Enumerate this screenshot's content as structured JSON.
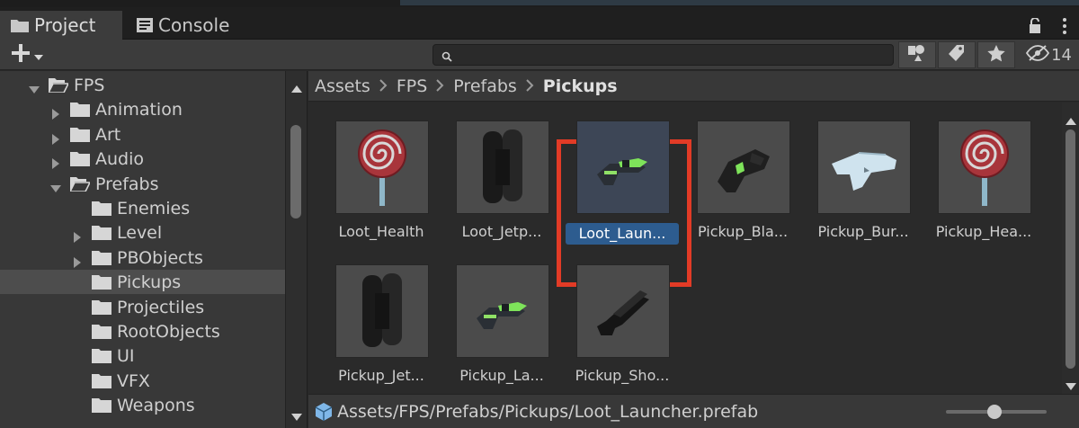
{
  "tabs": [
    {
      "label": "Project",
      "icon": "folder-icon",
      "active": true
    },
    {
      "label": "Console",
      "icon": "console-icon",
      "active": false
    }
  ],
  "toolbar": {
    "create_icon": "plus-icon",
    "search_placeholder": "",
    "hidden_count": "14"
  },
  "tree": {
    "items": [
      {
        "label": "FPS",
        "expanded": true,
        "has_children": true
      },
      {
        "label": "Animation",
        "expanded": false,
        "has_children": true
      },
      {
        "label": "Art",
        "expanded": false,
        "has_children": true
      },
      {
        "label": "Audio",
        "expanded": false,
        "has_children": true
      },
      {
        "label": "Prefabs",
        "expanded": true,
        "has_children": true
      },
      {
        "label": "Enemies",
        "expanded": false,
        "has_children": false
      },
      {
        "label": "Level",
        "expanded": false,
        "has_children": true
      },
      {
        "label": "PBObjects",
        "expanded": false,
        "has_children": true
      },
      {
        "label": "Pickups",
        "expanded": false,
        "has_children": false,
        "selected": true
      },
      {
        "label": "Projectiles",
        "expanded": false,
        "has_children": false
      },
      {
        "label": "RootObjects",
        "expanded": false,
        "has_children": false
      },
      {
        "label": "UI",
        "expanded": false,
        "has_children": false
      },
      {
        "label": "VFX",
        "expanded": false,
        "has_children": false
      },
      {
        "label": "Weapons",
        "expanded": false,
        "has_children": false
      }
    ]
  },
  "breadcrumb": [
    "Assets",
    "FPS",
    "Prefabs",
    "Pickups"
  ],
  "assets": [
    {
      "name": "Loot_Health",
      "thumb": "lollipop"
    },
    {
      "name": "Loot_Jetp...",
      "thumb": "jetpack"
    },
    {
      "name": "Loot_Laun...",
      "thumb": "launcher",
      "selected": true
    },
    {
      "name": "Pickup_Bla...",
      "thumb": "blaster"
    },
    {
      "name": "Pickup_Bur...",
      "thumb": "burst"
    },
    {
      "name": "Pickup_Hea...",
      "thumb": "lollipop"
    },
    {
      "name": "Pickup_Jet...",
      "thumb": "jetpack"
    },
    {
      "name": "Pickup_La...",
      "thumb": "launcher"
    },
    {
      "name": "Pickup_Sho...",
      "thumb": "shotgun"
    }
  ],
  "status": {
    "path": "Assets/FPS/Prefabs/Pickups/Loot_Launcher.prefab",
    "icon": "prefab-cube-icon"
  },
  "colors": {
    "highlight": "#e23b26",
    "selection": "#2d5c8f"
  }
}
